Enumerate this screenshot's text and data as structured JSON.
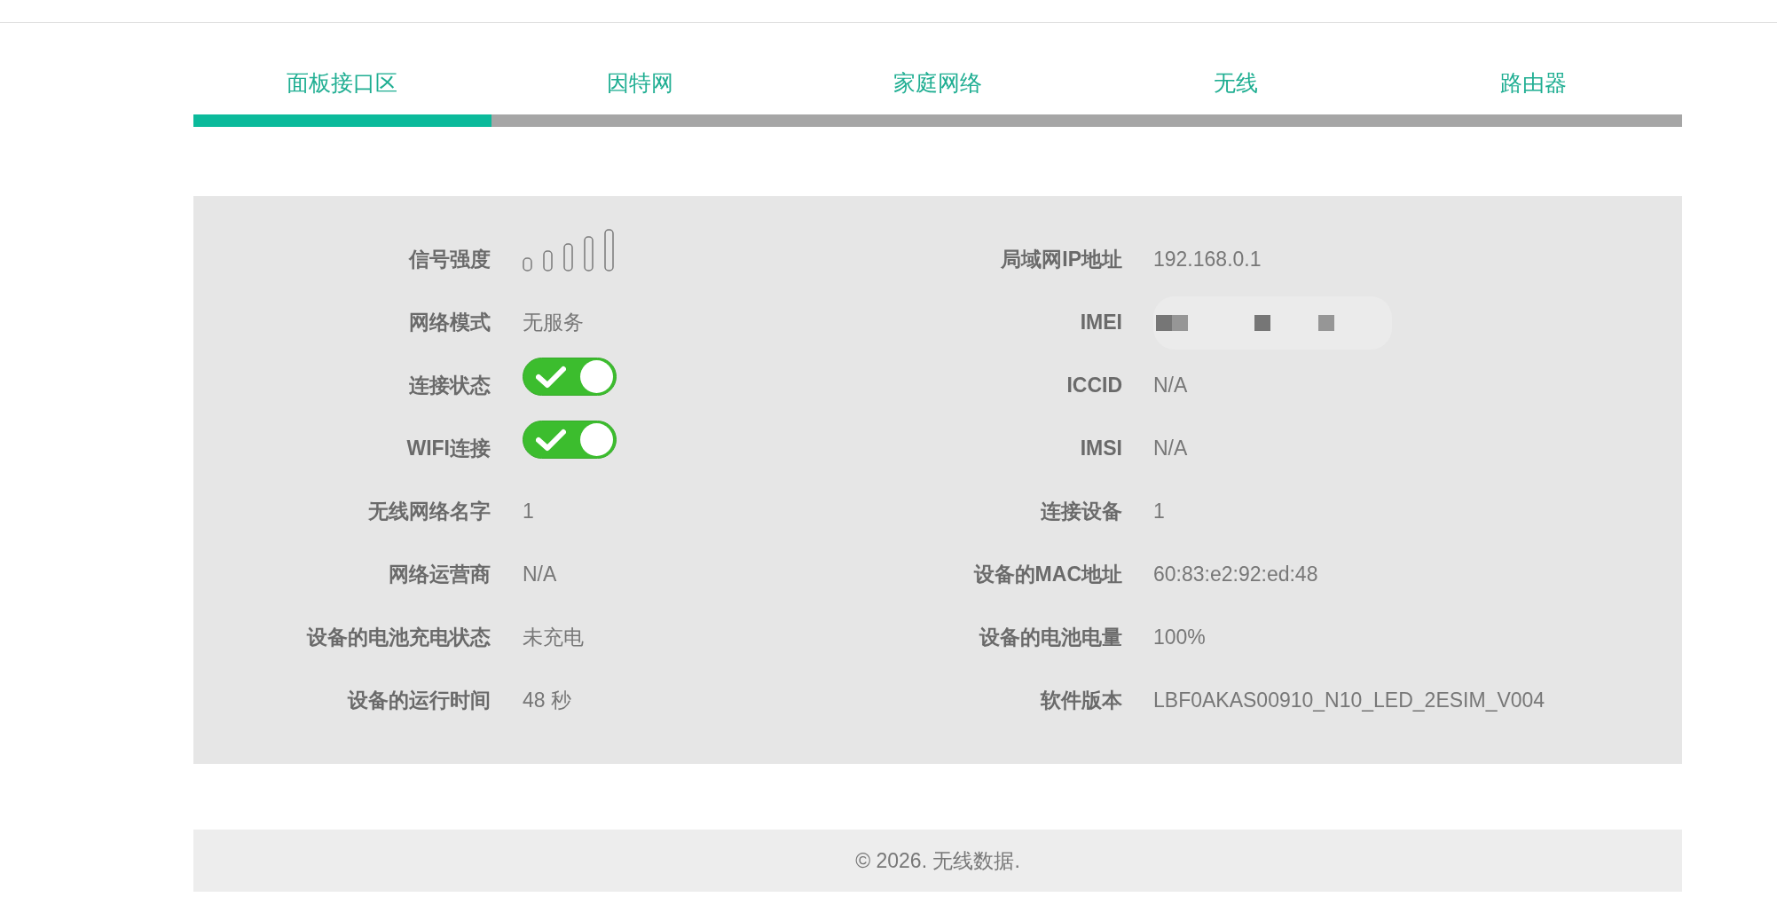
{
  "tabs": [
    {
      "label": "面板接口区",
      "selected": true
    },
    {
      "label": "因特网",
      "selected": false
    },
    {
      "label": "家庭网络",
      "selected": false
    },
    {
      "label": "无线",
      "selected": false
    },
    {
      "label": "路由器",
      "selected": false
    }
  ],
  "status_panel": {
    "left_column": [
      {
        "label": "信号强度",
        "kind": "signal"
      },
      {
        "label": "网络模式",
        "kind": "text",
        "value": "无服务"
      },
      {
        "label": "连接状态",
        "kind": "toggle",
        "on": true
      },
      {
        "label": "WIFI连接",
        "kind": "toggle",
        "on": true
      },
      {
        "label": "无线网络名字",
        "kind": "text",
        "value": "1"
      },
      {
        "label": "网络运营商",
        "kind": "text",
        "value": "N/A"
      },
      {
        "label": "设备的电池充电状态",
        "kind": "text",
        "value": "未充电"
      },
      {
        "label": "设备的运行时间",
        "kind": "text",
        "value": "48 秒"
      }
    ],
    "right_column": [
      {
        "label": "局域网IP地址",
        "kind": "text",
        "value": "192.168.0.1"
      },
      {
        "label": "IMEI",
        "kind": "redacted"
      },
      {
        "label": "ICCID",
        "kind": "text",
        "value": "N/A"
      },
      {
        "label": "IMSI",
        "kind": "text",
        "value": "N/A"
      },
      {
        "label": "连接设备",
        "kind": "text",
        "value": "1"
      },
      {
        "label": "设备的MAC地址",
        "kind": "text",
        "value": "60:83:e2:92:ed:48"
      },
      {
        "label": "设备的电池电量",
        "kind": "text",
        "value": "100%"
      },
      {
        "label": "软件版本",
        "kind": "text",
        "value": "LBF0AKAS00910_N10_LED_2ESIM_V004"
      }
    ]
  },
  "footer": {
    "text": "© 2026. 无线数据."
  }
}
